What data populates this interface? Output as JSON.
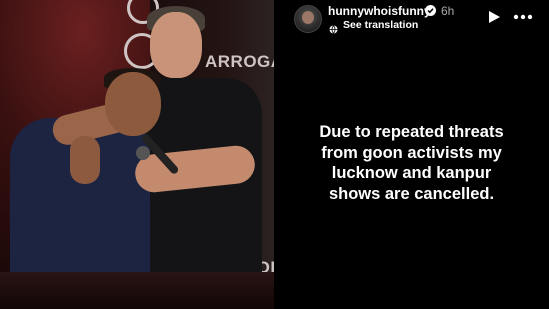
{
  "post": {
    "username": "hunnywhoisfunny",
    "time": "6h",
    "translation_label": "See translation",
    "caption": "Due to repeated threats\nfrom goon activists my\nlucknow and kanpur\nshows are cancelled."
  },
  "photo": {
    "panel_words": [
      "ARROGA",
      "SHOI"
    ]
  },
  "icons": {
    "verified": "verified-badge-icon",
    "translate": "globe-icon",
    "play": "play-icon",
    "more": "more-options-icon"
  },
  "colors": {
    "background": "#000000",
    "text": "#ffffff",
    "muted": "#a8a8a8"
  }
}
